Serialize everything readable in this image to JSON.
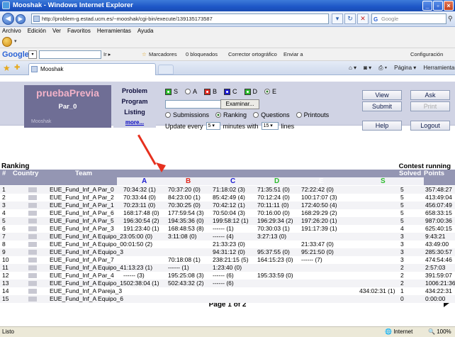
{
  "window": {
    "title": "Mooshak - Windows Internet Explorer",
    "url": "http://problem-g.estad.ucm.es/~mooshak/cgi-bin/execute/139135173587",
    "search_placeholder": "Google"
  },
  "menu": [
    "Archivo",
    "Edición",
    "Ver",
    "Favoritos",
    "Herramientas",
    "Ayuda"
  ],
  "google_toolbar": {
    "logo": "Google",
    "go_label": "Ir",
    "bookmarks": "Marcadores",
    "blocked": "0 bloqueados",
    "spellcheck": "Corrector ortográfico",
    "send": "Enviar a",
    "settings": "Configuración"
  },
  "tab": {
    "title": "Mooshak"
  },
  "command_bar": {
    "page": "Página",
    "tools": "Herramientas"
  },
  "mooshak": {
    "contest_name": "pruebaPrevia",
    "group": "Par_0",
    "logo_text": "Mooshak",
    "labels": {
      "problem": "Problem",
      "program": "Program",
      "listing": "Listing",
      "more": "more..."
    },
    "problems": [
      {
        "letter": "S",
        "color": "#2dbb2d"
      },
      {
        "letter": "A",
        "color": null
      },
      {
        "letter": "B",
        "color": "#e02a20"
      },
      {
        "letter": "C",
        "color": "#1a1ad0"
      },
      {
        "letter": "D",
        "color": "#2dbb2d"
      },
      {
        "letter": "E",
        "color": null
      }
    ],
    "selected_problem": "E",
    "browse_button": "Examinar...",
    "views": [
      "Submissions",
      "Ranking",
      "Questions",
      "Printouts"
    ],
    "selected_view": "Ranking",
    "update": {
      "prefix": "Update every",
      "minutes": "5",
      "mid": "minutes  with",
      "lines": "15",
      "suffix": "lines"
    },
    "buttons": {
      "view": "View",
      "submit": "Submit",
      "help": "Help",
      "ask": "Ask",
      "print": "Print",
      "logout": "Logout"
    }
  },
  "ranking": {
    "title": "Ranking",
    "status": "Contest running",
    "headers": {
      "rank": "#",
      "country": "Country",
      "team": "Team",
      "solved": "Solved",
      "points": "Points"
    },
    "problem_columns": [
      {
        "letter": "A",
        "color": "#1a1ad0"
      },
      {
        "letter": "B",
        "color": "#e02a20"
      },
      {
        "letter": "C",
        "color": "#1a1ad0"
      },
      {
        "letter": "D",
        "color": "#2dbb2d"
      },
      {
        "letter": "E",
        "color": "#ffffff"
      },
      {
        "letter": "S",
        "color": "#2dbb2d"
      }
    ],
    "rows": [
      {
        "rank": "1",
        "team": "EUE_Fund_Inf_A Par_0",
        "A": "70:34:32 (1)",
        "B": "70:37:20 (0)",
        "C": "71:18:02 (3)",
        "D": "71:35:51 (0)",
        "E": "72:22:42 (0)",
        "S": "",
        "solved": "5",
        "points": "357:48:27"
      },
      {
        "rank": "2",
        "team": "EUE_Fund_Inf_A Par_2",
        "A": "70:33:44 (0)",
        "B": "84:23:00 (1)",
        "C": "85:42:49 (4)",
        "D": "70:12:24 (0)",
        "E": "100:17:07 (3)",
        "S": "",
        "solved": "5",
        "points": "413:49:04"
      },
      {
        "rank": "3",
        "team": "EUE_Fund_Inf_A Par_1",
        "A": "70:23:11 (0)",
        "B": "70:30:25 (0)",
        "C": "70:42:12 (1)",
        "D": "70:11:11 (0)",
        "E": "172:40:50 (4)",
        "S": "",
        "solved": "5",
        "points": "456:07:49"
      },
      {
        "rank": "4",
        "team": "EUE_Fund_Inf_A Par_6",
        "A": "168:17:48 (0)",
        "B": "177:59:54 (3)",
        "C": "70:50:04 (3)",
        "D": "70:16:00 (0)",
        "E": "168:29:29 (2)",
        "S": "",
        "solved": "5",
        "points": "658:33:15"
      },
      {
        "rank": "5",
        "team": "EUE_Fund_Inf_A Par_5",
        "A": "196:30:54 (2)",
        "B": "194:35:36 (0)",
        "C": "199:58:12 (1)",
        "D": "196:29:34 (2)",
        "E": "197:26:20 (1)",
        "S": "",
        "solved": "5",
        "points": "987:00:36"
      },
      {
        "rank": "6",
        "team": "EUE_Fund_Inf_A Par_3",
        "A": "191:23:40 (1)",
        "B": "168:48:53 (8)",
        "C": "------ (1)",
        "D": "70:30:03 (1)",
        "E": "191:17:39 (1)",
        "S": "",
        "solved": "4",
        "points": "625:40:15"
      },
      {
        "rank": "7",
        "team": "EUE_Fund_Inf_A Equipo_2",
        "A": "3:05:00 (0)",
        "B": "3:11:08 (0)",
        "C": "------ (4)",
        "D": "3:27:13 (0)",
        "E": "",
        "S": "",
        "solved": "3",
        "points": "9:43:21"
      },
      {
        "rank": "8",
        "team": "EUE_Fund_Inf_A Equipo_0",
        "A": "0:01:50 (2)",
        "B": "",
        "C": "21:33:23 (0)",
        "D": "",
        "E": "21:33:47 (0)",
        "S": "",
        "solved": "3",
        "points": "43:49:00"
      },
      {
        "rank": "9",
        "team": "EUE_Fund_Inf_A Equipo_3",
        "A": "",
        "B": "",
        "C": "94:31:12 (0)",
        "D": "95:37:55 (0)",
        "E": "95:21:50 (0)",
        "S": "",
        "solved": "3",
        "points": "285:30:57"
      },
      {
        "rank": "10",
        "team": "EUE_Fund_Inf_A Par_7",
        "A": "",
        "B": "70:18:08 (1)",
        "C": "238:21:15 (5)",
        "D": "164:15:23 (0)",
        "E": "------ (7)",
        "S": "",
        "solved": "3",
        "points": "474:54:46"
      },
      {
        "rank": "11",
        "team": "EUE_Fund_Inf_A Equipo_4",
        "A": "1:13:23 (1)",
        "B": "------ (1)",
        "C": "1:23:40 (0)",
        "D": "",
        "E": "",
        "S": "",
        "solved": "2",
        "points": "2:57:03"
      },
      {
        "rank": "12",
        "team": "EUE_Fund_Inf_A Par_4",
        "A": "------ (3)",
        "B": "195:25:08 (3)",
        "C": "------ (6)",
        "D": "195:33:59 (0)",
        "E": "",
        "S": "",
        "solved": "2",
        "points": "391:59:07"
      },
      {
        "rank": "13",
        "team": "EUE_Fund_Inf_A Equipo_1",
        "A": "502:38:04 (1)",
        "B": "502:43:32 (2)",
        "C": "------ (6)",
        "D": "",
        "E": "",
        "S": "",
        "solved": "2",
        "points": "1006:21:36"
      },
      {
        "rank": "14",
        "team": "EUE_Fund_Inf_A Pareja_3",
        "A": "",
        "B": "",
        "C": "",
        "D": "",
        "E": "",
        "S": "434:02:31 (1)",
        "solved": "1",
        "points": "434:22:31"
      },
      {
        "rank": "15",
        "team": "EUE_Fund_Inf_A Equipo_6",
        "A": "",
        "B": "",
        "C": "",
        "D": "",
        "E": "",
        "S": "",
        "solved": "0",
        "points": "0:00:00"
      }
    ],
    "pager": "Page 1 of 2"
  },
  "statusbar": {
    "text": "Listo",
    "zone": "Internet",
    "zoom": "100%"
  }
}
